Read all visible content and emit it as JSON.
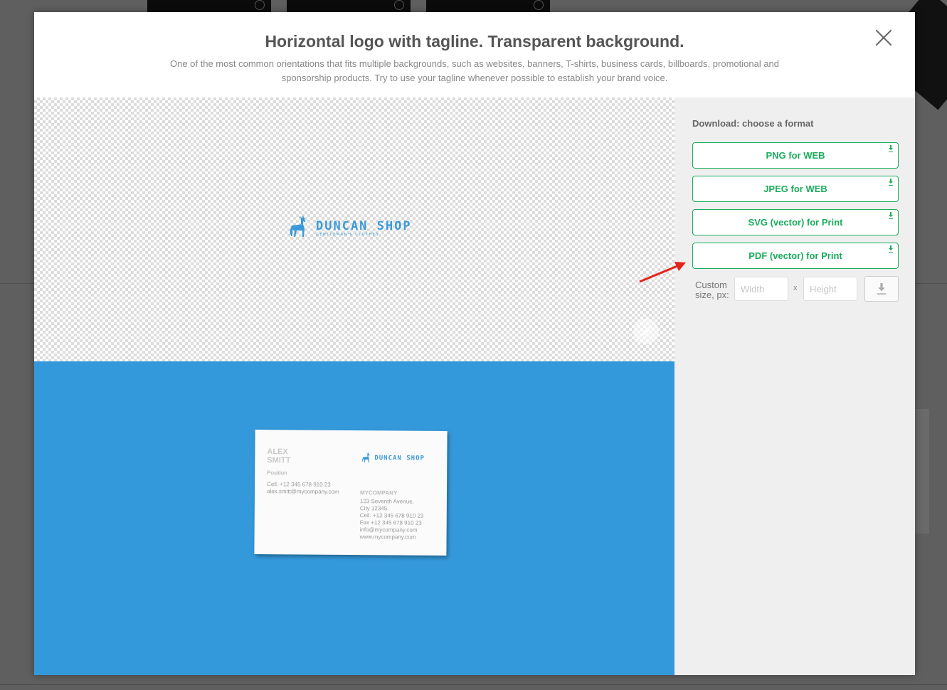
{
  "modal": {
    "title": "Horizontal logo with tagline. Transparent background.",
    "description": "One of the most common orientations that fits multiple backgrounds, such as websites, banners, T-shirts, business cards, billboards, promotional and sponsorship products. Try to use your tagline whenever possible to establish your brand voice."
  },
  "preview": {
    "logo_name": "DUNCAN SHOP",
    "logo_tagline": "GENTLEMAN'S CLOTHES",
    "mockup_color": "#3499db",
    "business_card": {
      "name_line1": "ALEX",
      "name_line2": "SMITT",
      "position": "Position",
      "cell": "Cell. +12 345 678 910 23",
      "email": "alex.smitt@mycompany.com",
      "logo_name": "DUNCAN SHOP",
      "company": "MYCOMPANY",
      "address1": "123 Seventh Avenue,",
      "address2": "City 12345",
      "cell2": "Cell. +12 345 678 910 23",
      "fax": "Fax  +12 345 678 910 23",
      "info_email": "info@mycompany.com",
      "website": "www.mycompany.com"
    }
  },
  "panel": {
    "title": "Download: choose a format",
    "formats": [
      {
        "label": "PNG for WEB"
      },
      {
        "label": "JPEG for WEB"
      },
      {
        "label": "SVG (vector) for Print"
      },
      {
        "label": "PDF (vector) for Print"
      }
    ],
    "custom_label_line1": "Custom",
    "custom_label_line2": "size, px:",
    "width_placeholder": "Width",
    "height_placeholder": "Height",
    "times": "x",
    "accent_color": "#1aac5c"
  },
  "icons": {
    "close": "close-icon",
    "edit": "pencil-icon",
    "download": "download-icon",
    "arrow": "red-arrow-annotation"
  }
}
